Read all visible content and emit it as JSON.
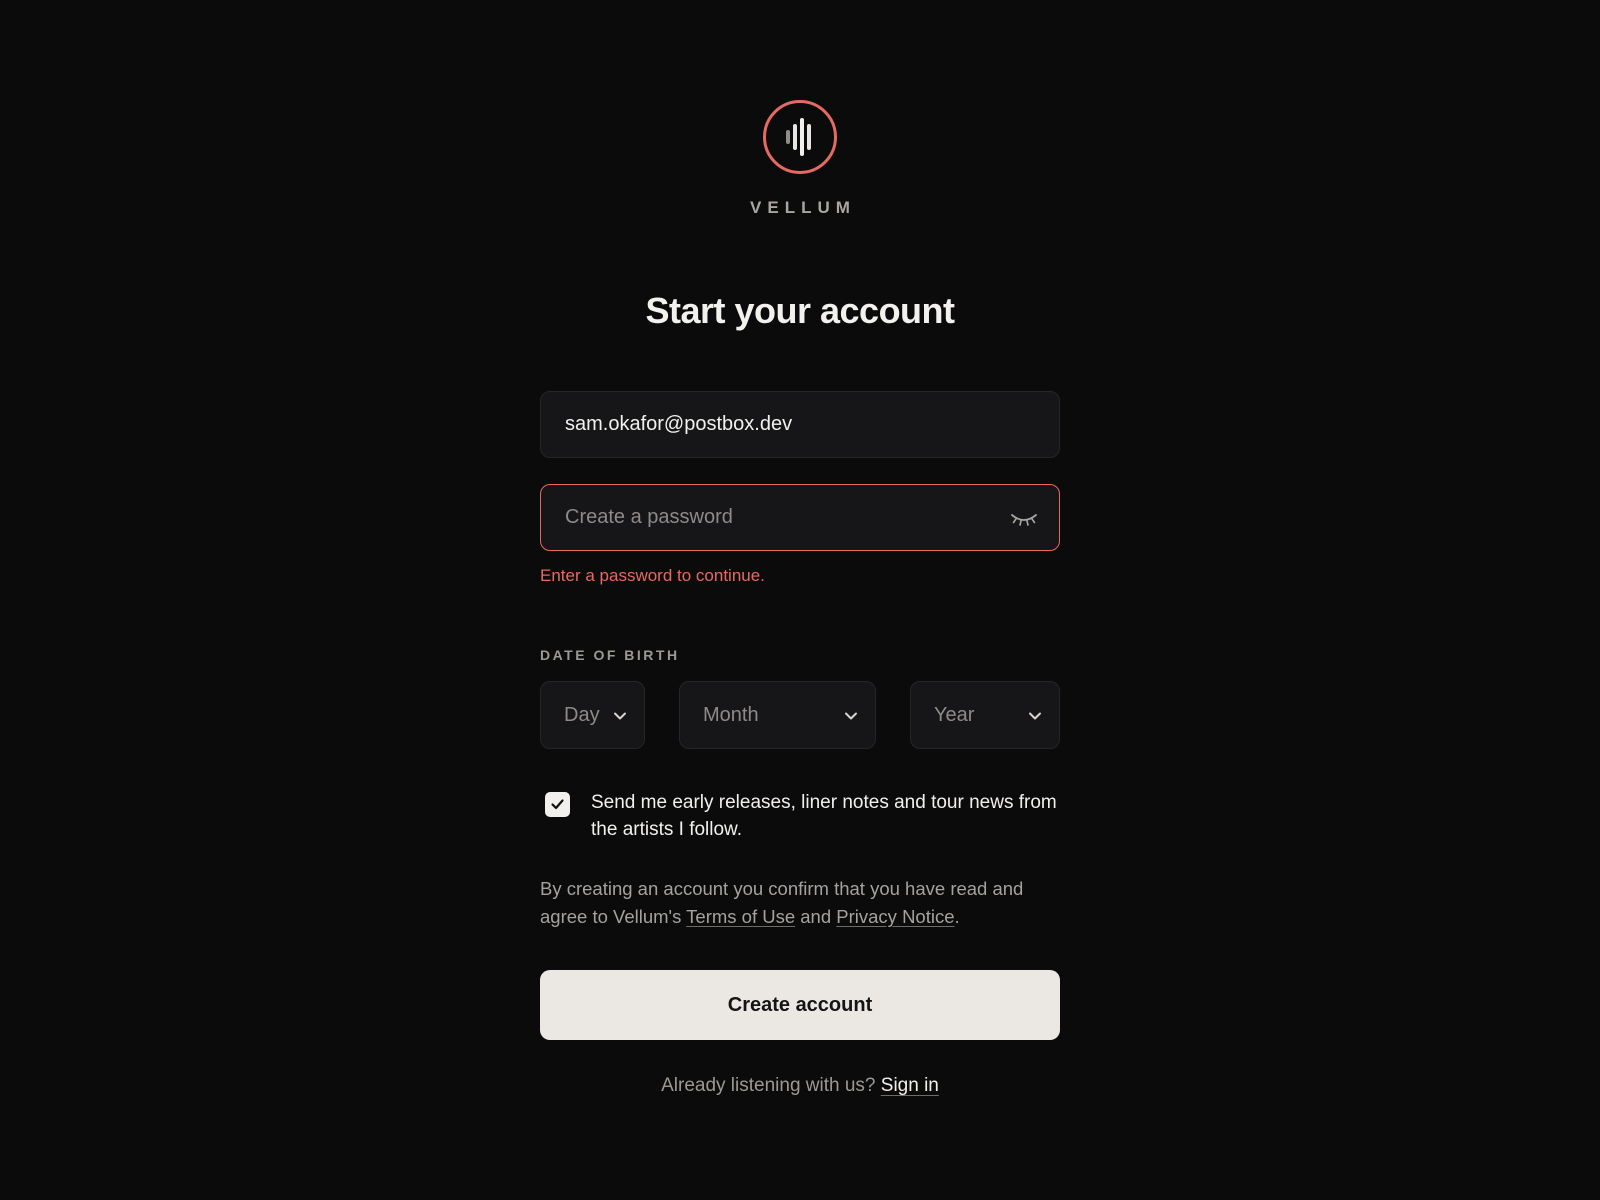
{
  "brand": {
    "name": "VELLUM",
    "logo_icon": "sound-wave-icon",
    "accent_color": "#e56a62"
  },
  "form": {
    "title": "Start your account",
    "email": {
      "value": "sam.okafor@postbox.dev",
      "placeholder": ""
    },
    "password": {
      "value": "",
      "placeholder": "Create a password",
      "toggle_icon": "eye-closed-icon",
      "error": "Enter a password to continue."
    },
    "dob": {
      "label": "DATE OF BIRTH",
      "day": "Day",
      "month": "Month",
      "year": "Year",
      "chevron_icon": "chevron-down-icon"
    },
    "marketing": {
      "checked": true,
      "label": "Send me early releases, liner notes and tour news from the artists I follow."
    },
    "legal": {
      "prefix": "By creating an account you confirm that you have read and agree to Vellum's",
      "terms": "Terms of Use",
      "and": "and",
      "privacy": "Privacy Notice",
      "suffix": "."
    },
    "submit_label": "Create account",
    "signin": {
      "prompt": "Already listening with us?",
      "link": "Sign in"
    }
  }
}
